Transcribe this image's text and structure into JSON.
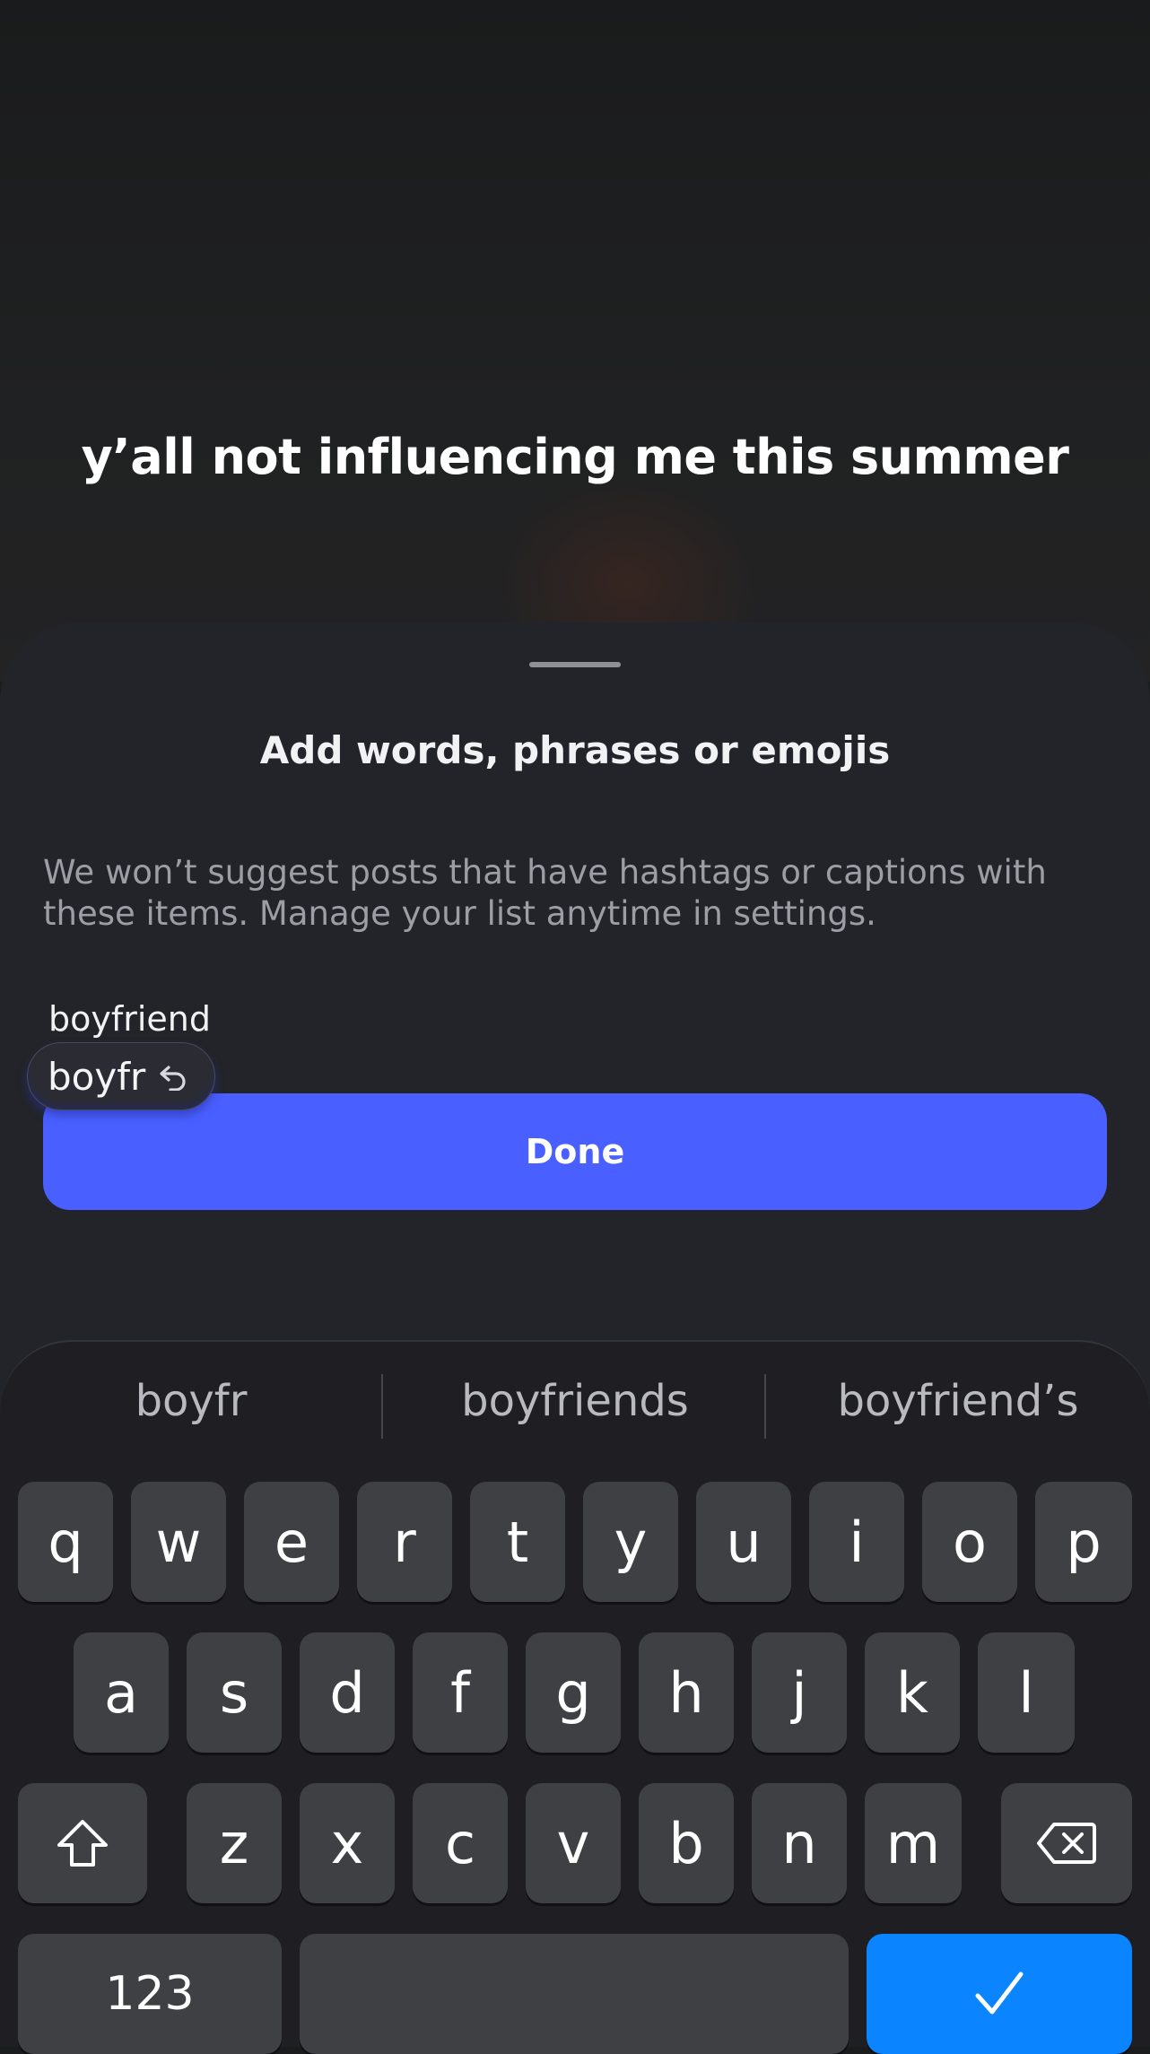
{
  "caption": "y’all not influencing me this summer",
  "sheet": {
    "title": "Add words, phrases or emojis",
    "description": "We won’t suggest posts that have hashtags or captions with these items. Manage your list anytime in settings.",
    "input_value": "boyfriend",
    "autocorrect_word": "boyfr",
    "done_label": "Done"
  },
  "keyboard": {
    "suggestions": [
      "boyfr",
      "boyfriends",
      "boyfriend’s"
    ],
    "row1": [
      "q",
      "w",
      "e",
      "r",
      "t",
      "y",
      "u",
      "i",
      "o",
      "p"
    ],
    "row2": [
      "a",
      "s",
      "d",
      "f",
      "g",
      "h",
      "j",
      "k",
      "l"
    ],
    "row3": [
      "z",
      "x",
      "c",
      "v",
      "b",
      "n",
      "m"
    ],
    "numbers_label": "123",
    "icons": {
      "shift": "shift-icon",
      "delete": "backspace-icon",
      "return": "checkmark-icon",
      "undo": "undo-icon"
    },
    "return_color": "#0a84ff"
  },
  "colors": {
    "done_button": "#4a5fff",
    "sheet_background": "#232429"
  }
}
